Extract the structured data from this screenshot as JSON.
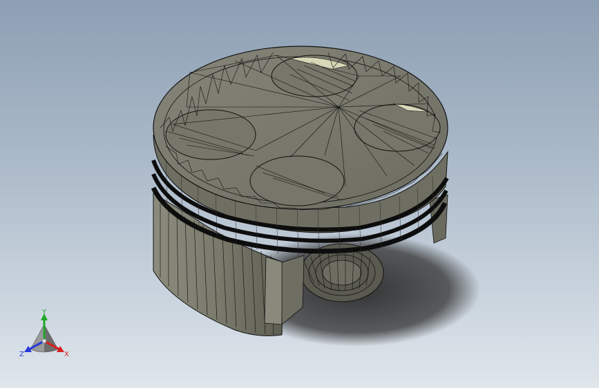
{
  "viewport": {
    "background_top": "#8c9fb3",
    "background_bottom": "#dfe6ec"
  },
  "model": {
    "name": "piston",
    "fill_color": "#7a7a6e",
    "edge_color": "#111111",
    "highlight_color": "#d8d8b8"
  },
  "triad": {
    "x_label": "X",
    "y_label": "Y",
    "z_label": "Z",
    "x_color": "#d62020",
    "y_color": "#1fa82c",
    "z_color": "#2a3bd8"
  }
}
